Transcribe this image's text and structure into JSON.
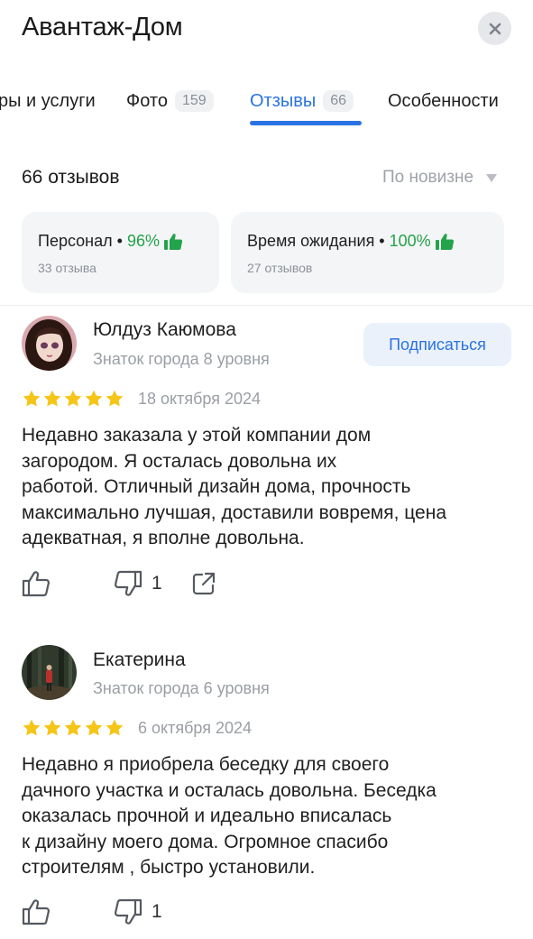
{
  "header": {
    "title": "Авантаж-Дом"
  },
  "tabs": [
    {
      "label": "ры и услуги",
      "count": ""
    },
    {
      "label": "Фото",
      "count": "159"
    },
    {
      "label": "Отзывы",
      "count": "66"
    },
    {
      "label": "Особенности",
      "count": ""
    }
  ],
  "summary": {
    "count_text": "66 отзывов",
    "sort_label": "По новизне"
  },
  "aspects": [
    {
      "name": "Персонал •",
      "percent": "96%",
      "sub": "33 отзыва"
    },
    {
      "name": "Время ожидания •",
      "percent": "100%",
      "sub": "27 отзывов"
    }
  ],
  "reviews": [
    {
      "author": "Юлдуз Каюмова",
      "level": "Знаток города 8 уровня",
      "subscribe_label": "Подписаться",
      "rating": 5,
      "date": "18 октября 2024",
      "lines": [
        "Недавно заказала у этой компании дом",
        "загородом. Я осталась довольна их",
        "работой. Отличный дизайн дома, прочность",
        "максимально лучшая, доставили вовремя, цена",
        "адекватная, я вполне довольна."
      ],
      "dislikes": "1"
    },
    {
      "author": "Екатерина",
      "level": "Знаток города 6 уровня",
      "rating": 5,
      "date": "6 октября 2024",
      "lines": [
        "Недавно я приобрела беседку для своего",
        "дачного участка и осталась довольна. Беседка",
        "оказалась прочной и идеально вписалась",
        "к дизайну моего дома. Огромное спасибо",
        "строителям , быстро установили."
      ],
      "dislikes": "1"
    }
  ],
  "colors": {
    "accent": "#2b73e4",
    "positive": "#23a34a",
    "star": "#f5c518"
  }
}
